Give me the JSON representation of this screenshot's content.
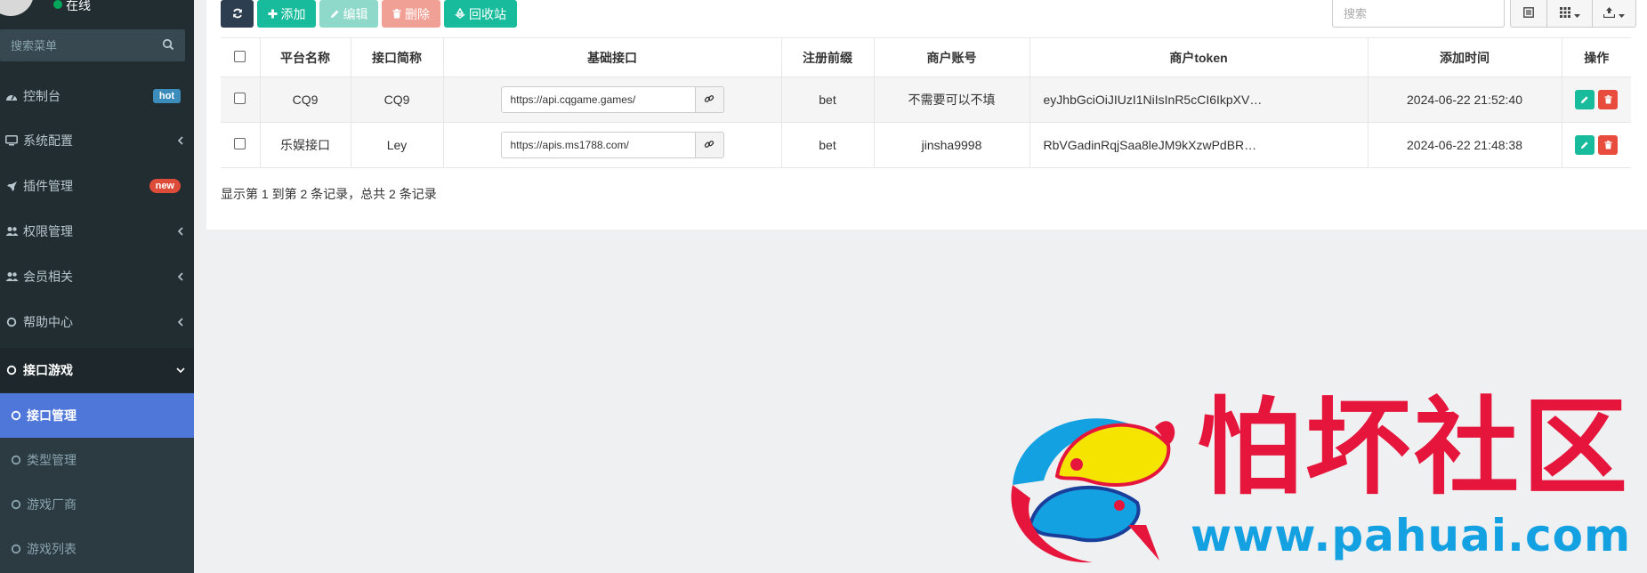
{
  "sidebar": {
    "status_text": "在线",
    "search_placeholder": "搜索菜单",
    "items": [
      {
        "label": "控制台",
        "icon": "dashboard-icon",
        "badge": "hot"
      },
      {
        "label": "系统配置",
        "icon": "desktop-icon"
      },
      {
        "label": "插件管理",
        "icon": "rocket-icon",
        "badge": "new"
      },
      {
        "label": "权限管理",
        "icon": "users-icon"
      },
      {
        "label": "会员相关",
        "icon": "users-icon"
      },
      {
        "label": "帮助中心",
        "icon": "circle-icon"
      },
      {
        "label": "接口游戏",
        "icon": "circle-icon",
        "open": true
      }
    ],
    "subitems": [
      {
        "label": "接口管理",
        "active": true
      },
      {
        "label": "类型管理"
      },
      {
        "label": "游戏厂商"
      },
      {
        "label": "游戏列表"
      }
    ]
  },
  "toolbar": {
    "add_label": "添加",
    "edit_label": "编辑",
    "delete_label": "删除",
    "recycle_label": "回收站",
    "search_placeholder": "搜索"
  },
  "table": {
    "columns": [
      "平台名称",
      "接口简称",
      "基础接口",
      "注册前缀",
      "商户账号",
      "商户token",
      "添加时间",
      "操作"
    ],
    "rows": [
      {
        "platform": "CQ9",
        "short": "CQ9",
        "url": "https://api.cqgame.games/",
        "prefix": "bet",
        "account": "不需要可以不填",
        "token": "eyJhbGciOiJIUzI1NiIsInR5cCI6IkpXV…",
        "time": "2024-06-22 21:52:40"
      },
      {
        "platform": "乐娱接口",
        "short": "Ley",
        "url": "https://apis.ms1788.com/",
        "prefix": "bet",
        "account": "jinsha9998",
        "token": "RbVGadinRqjSaa8leJM9kXzwPdBR…",
        "time": "2024-06-22 21:48:38"
      }
    ]
  },
  "pagination": {
    "info": "显示第 1 到第 2 条记录，总共 2 条记录"
  },
  "watermark": {
    "title": "怕坏社区",
    "url": "www.pahuai.com"
  },
  "colors": {
    "sidebar_bg": "#222d32",
    "active_item": "#4f77da",
    "success": "#18bc9c",
    "danger": "#e74c3c",
    "primary_dark": "#2c3e50",
    "watermark_red": "#e5153c",
    "watermark_blue": "#14a1e2"
  }
}
